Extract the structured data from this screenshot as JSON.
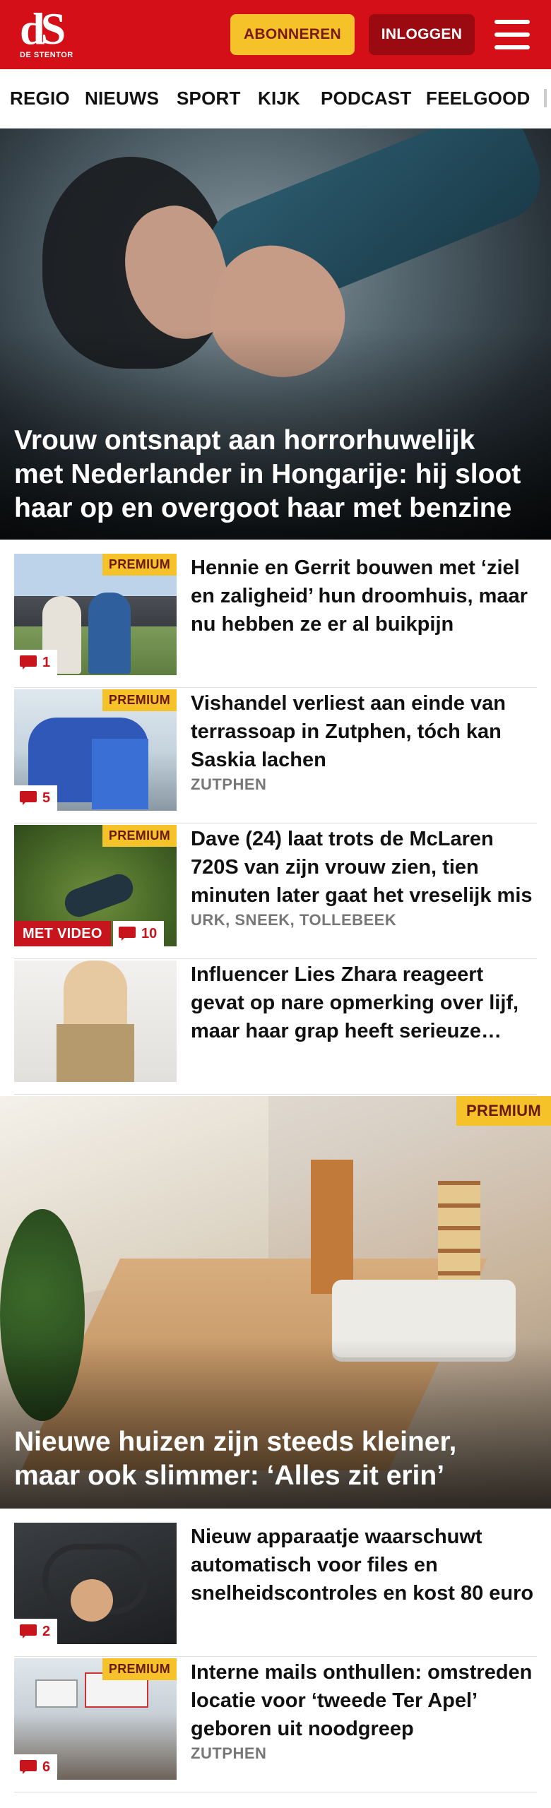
{
  "header": {
    "logo_mark": "dS",
    "logo_sub": "DE STENTOR",
    "subscribe_label": "ABONNEREN",
    "login_label": "INLOGGEN"
  },
  "nav": {
    "items": [
      "REGIO",
      "NIEUWS",
      "SPORT",
      "KIJK",
      "PODCAST",
      "FEELGOOD"
    ]
  },
  "hero": {
    "title": "Vrouw ontsnapt aan horrorhuwelijk met Nederlander in Hongarije: hij sloot haar op en overgoot haar met benzine"
  },
  "articles": [
    {
      "title": "Hennie en Gerrit bouwen met ‘ziel en zaligheid’ hun droomhuis, maar nu hebben ze er al buikpijn",
      "premium": "PREMIUM",
      "comments": "1",
      "location": ""
    },
    {
      "title": "Vishandel verliest aan einde van terrassoap in Zutphen, tóch kan Saskia lachen",
      "premium": "PREMIUM",
      "comments": "5",
      "location": "ZUTPHEN"
    },
    {
      "title": "Dave (24) laat trots de McLaren 720S van zijn vrouw zien, tien minuten later gaat het vreselijk mis",
      "premium": "PREMIUM",
      "comments": "10",
      "video": "MET VIDEO",
      "location": "URK, SNEEK, TOLLEBEEK"
    },
    {
      "title": "Influencer Lies Zhara reageert gevat op nare opmerking over lijf, maar haar grap heeft serieuze ondertoon",
      "location": ""
    }
  ],
  "feature": {
    "premium": "PREMIUM",
    "title": "Nieuwe huizen zijn steeds kleiner, maar ook slimmer: ‘Alles zit erin’"
  },
  "articles2": [
    {
      "title": "Nieuw apparaatje waarschuwt automatisch voor files en snelheidscontroles en kost 80 euro",
      "comments": "2",
      "location": ""
    },
    {
      "title": "Interne mails onthullen: omstreden locatie voor ‘tweede Ter Apel’ geboren uit noodgreep",
      "premium": "PREMIUM",
      "comments": "6",
      "location": "ZUTPHEN"
    }
  ],
  "colors": {
    "brand_red": "#d40f18",
    "premium_yellow": "#f5c22a",
    "login_dark_red": "#9b0a10"
  }
}
